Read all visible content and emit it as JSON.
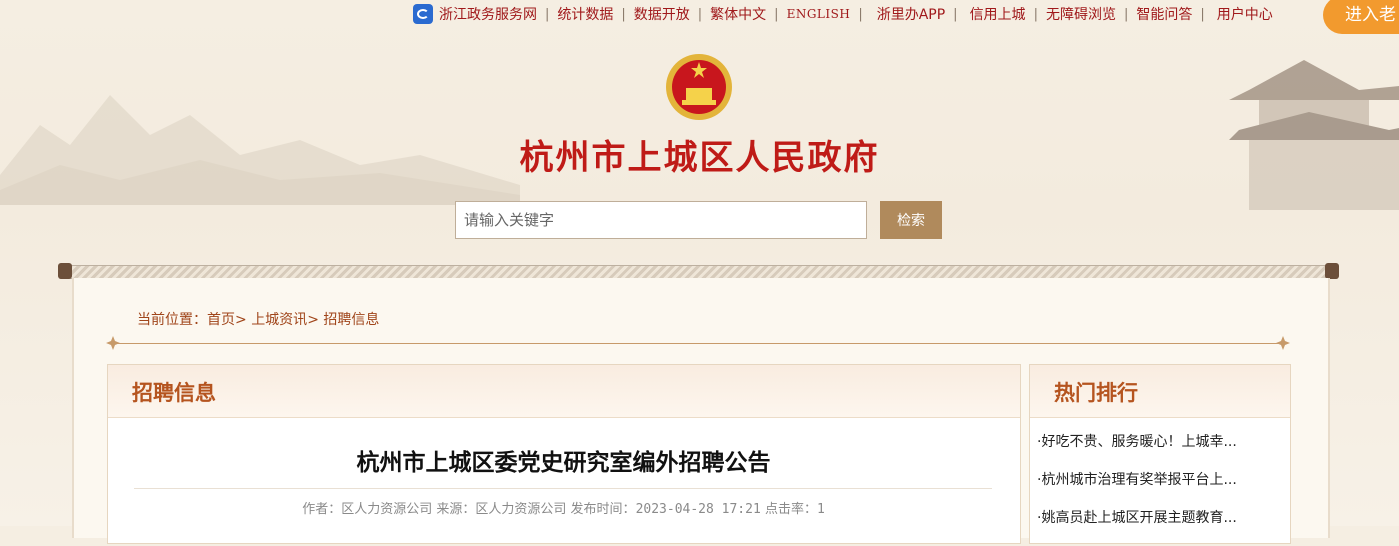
{
  "topnav": {
    "items": [
      "浙江政务服务网",
      "统计数据",
      "数据开放",
      "繁体中文",
      "ENGLISH",
      "浙里办APP",
      "信用上城",
      "无障碍浏览",
      "智能问答",
      "用户中心"
    ],
    "enter_old": "进入老"
  },
  "header": {
    "site_title": "杭州市上城区人民政府"
  },
  "search": {
    "placeholder": "请输入关键字",
    "button": "检索"
  },
  "breadcrumb": {
    "prefix": "当前位置：",
    "home": "首页",
    "section": "上城资讯",
    "current": "招聘信息",
    "sep": ">"
  },
  "main": {
    "panel_title": "招聘信息",
    "article_title": "杭州市上城区委党史研究室编外招聘公告",
    "meta": {
      "author_label": "作者：",
      "author": "区人力资源公司",
      "source_label": "来源：",
      "source": "区人力资源公司",
      "time_label": "发布时间：",
      "time": "2023-04-28 17:21",
      "clicks_label": "点击率：",
      "clicks": "1"
    }
  },
  "sidebar": {
    "title": "热门排行",
    "items": [
      "·好吃不贵、服务暖心！上城幸...",
      "·杭州城市治理有奖举报平台上...",
      "·姚高员赴上城区开展主题教育..."
    ]
  },
  "colors": {
    "accent": "#b5541f",
    "title_red": "#bf1b17",
    "button": "#b08a5c",
    "enter_old": "#f29a2e"
  }
}
